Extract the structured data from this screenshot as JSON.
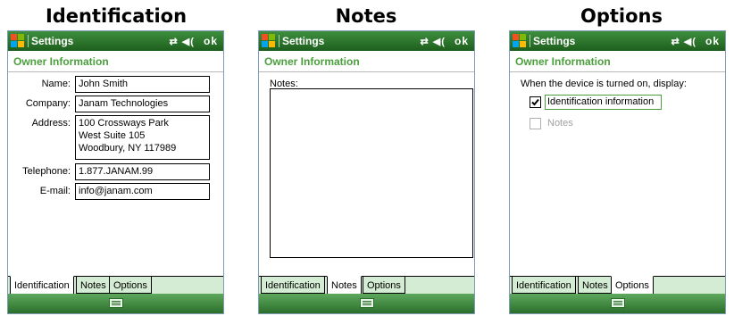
{
  "captions": [
    "Identification",
    "Notes",
    "Options"
  ],
  "screens": [
    {
      "app_title": "Settings",
      "tray_ok": "ok",
      "header": "Owner Information",
      "fields": {
        "name_label": "Name:",
        "name_value": "John Smith",
        "company_label": "Company:",
        "company_value": "Janam Technologies",
        "address_label": "Address:",
        "address_value": "100 Crossways Park\nWest Suite 105\nWoodbury, NY 117989",
        "telephone_label": "Telephone:",
        "telephone_value": "1.877.JANAM.99",
        "email_label": "E-mail:",
        "email_value": "info@janam.com"
      },
      "tabs": [
        "Identification",
        "Notes",
        "Options"
      ],
      "active_tab": "Identification"
    },
    {
      "app_title": "Settings",
      "tray_ok": "ok",
      "header": "Owner Information",
      "notes_label": "Notes:",
      "notes_value": "",
      "tabs": [
        "Identification",
        "Notes",
        "Options"
      ],
      "active_tab": "Notes"
    },
    {
      "app_title": "Settings",
      "tray_ok": "ok",
      "header": "Owner Information",
      "prompt": "When the device is turned on, display:",
      "option_identification": {
        "label": "Identification information",
        "checked": true
      },
      "option_notes": {
        "label": "Notes",
        "checked": false,
        "disabled": true
      },
      "tabs": [
        "Identification",
        "Notes",
        "Options"
      ],
      "active_tab": "Options"
    }
  ],
  "colors": {
    "titlebar": "#2a742a",
    "header_text": "#4a9e3c",
    "tab_bg": "#d4ecd4"
  }
}
